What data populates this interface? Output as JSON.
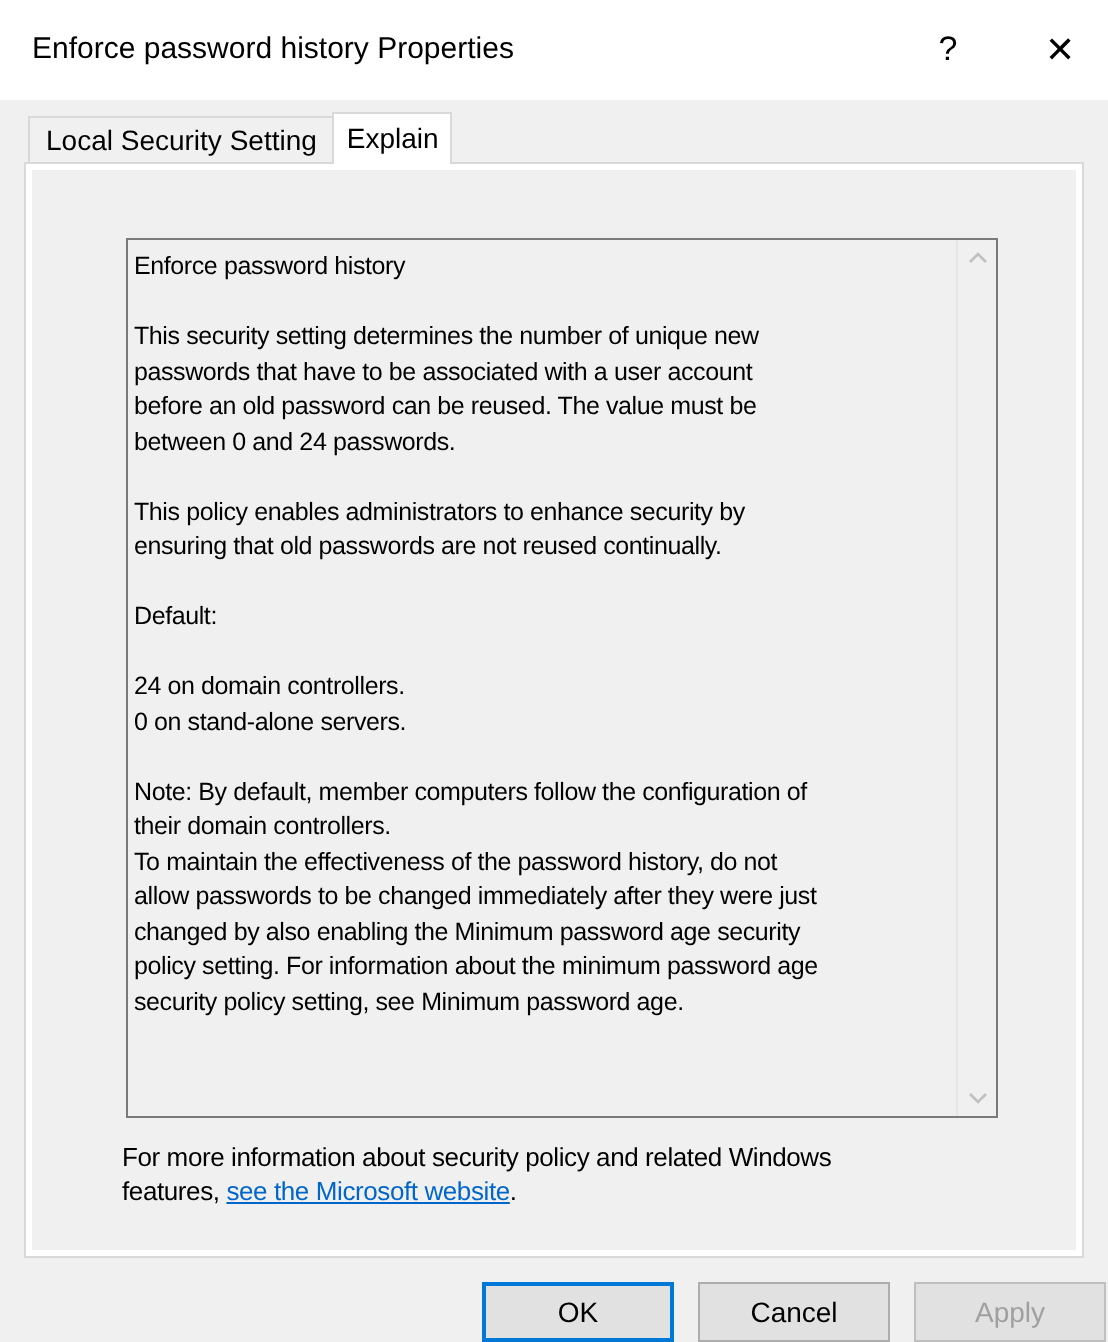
{
  "window": {
    "title": "Enforce password history Properties",
    "help": "?",
    "close": "✕"
  },
  "tabs": [
    {
      "label": "Local Security Setting",
      "selected": false
    },
    {
      "label": "Explain",
      "selected": true
    }
  ],
  "explain_text": [
    [
      "Enforce password history"
    ],
    [
      "This security setting determines the number of unique new",
      "passwords that have to be associated with a user account",
      "before an old password can be reused. The value must be",
      "between 0 and 24 passwords."
    ],
    [
      "This policy enables administrators to enhance security by",
      "ensuring that old passwords are not reused continually."
    ],
    [
      "Default:"
    ],
    [
      "24 on domain controllers.",
      "0 on stand-alone servers."
    ],
    [
      "Note: By default, member computers follow the configuration of",
      "their domain controllers.",
      "To maintain the effectiveness of the password history, do not",
      "allow passwords to be changed immediately after they were just",
      "changed by also enabling the Minimum password age security",
      "policy setting. For information about the minimum password age",
      "security policy setting, see Minimum password age."
    ]
  ],
  "more_info": {
    "text_line1": "For more information about security policy and related Windows",
    "text_before_link": "features,",
    "link": "see the Microsoft website",
    "text_after_link": "."
  },
  "buttons": [
    {
      "label": "OK",
      "default": true,
      "disabled": false
    },
    {
      "label": "Cancel",
      "default": false,
      "disabled": false
    },
    {
      "label": "Apply",
      "default": false,
      "disabled": true
    }
  ]
}
